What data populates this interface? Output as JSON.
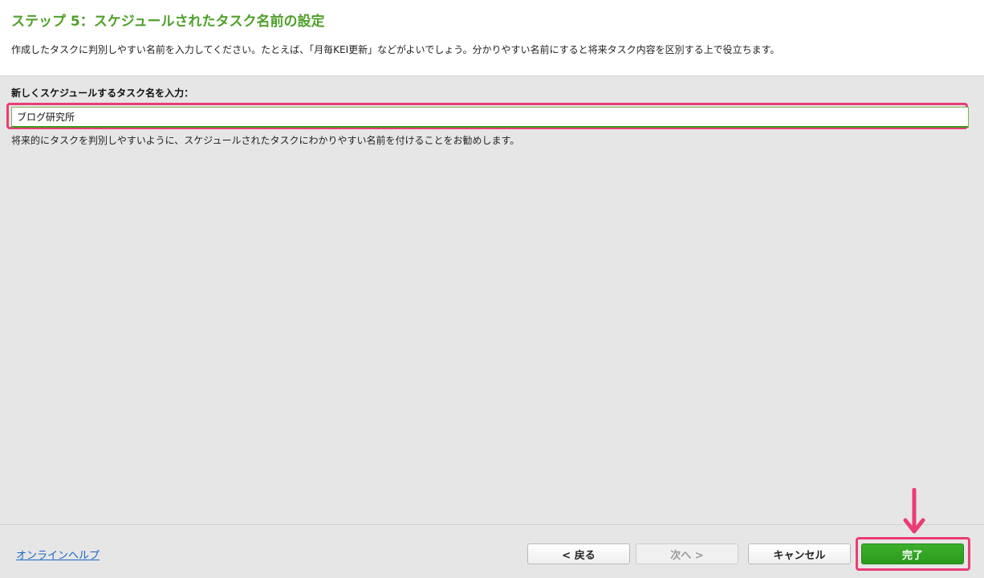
{
  "header": {
    "title": "ステップ 5：スケジュールされたタスク名前の設定",
    "description": "作成したタスクに判別しやすい名前を入力してください。たとえば、「月毎KEI更新」などがよいでしょう。分かりやすい名前にすると将来タスク内容を区別する上で役立ちます。"
  },
  "form": {
    "label": "新しくスケジュールするタスク名を入力：",
    "task_name_value": "ブログ研究所",
    "hint": "将来的にタスクを判別しやすいように、スケジュールされたタスクにわかりやすい名前を付けることをお勧めします。"
  },
  "footer": {
    "help_link": "オンラインヘルプ",
    "back_label": "< 戻る",
    "next_label": "次へ >",
    "cancel_label": "キャンセル",
    "finish_label": "完了"
  },
  "colors": {
    "accent_green": "#4fa02a",
    "finish_button": "#2a9a1c",
    "highlight_pink": "#ea3d74",
    "link_blue": "#1a66c7"
  },
  "icons": {
    "annotation_arrow": "down-arrow-icon"
  }
}
